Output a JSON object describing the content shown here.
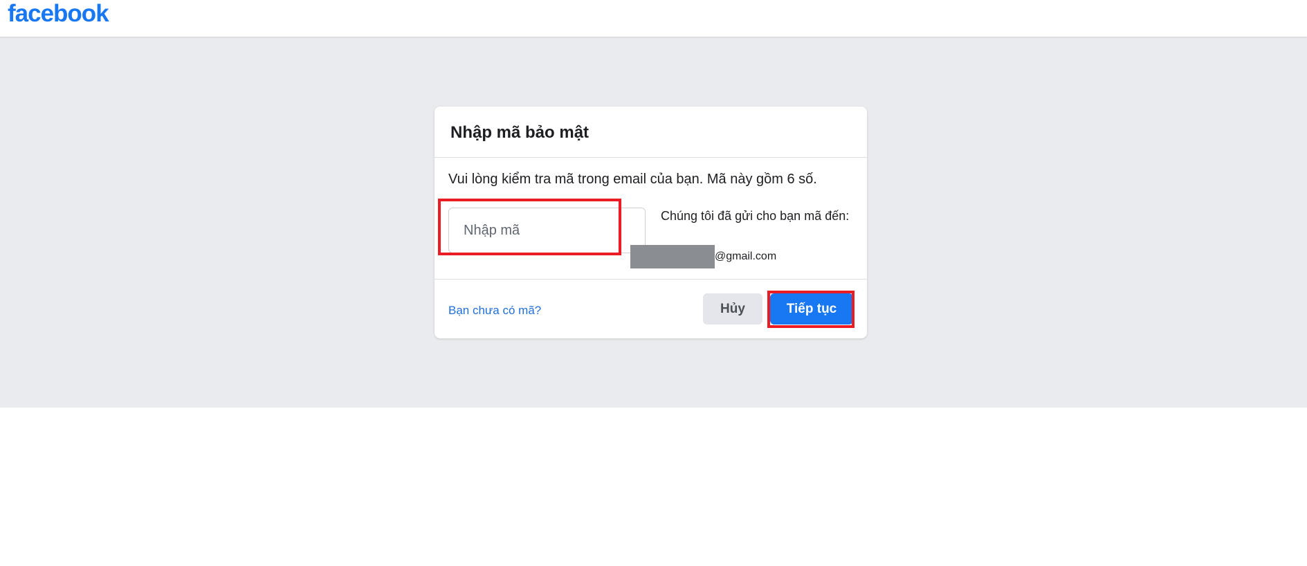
{
  "brand": {
    "logo_text": "facebook",
    "logo_color": "#1877f2"
  },
  "colors": {
    "page_background": "#e9ebee",
    "accent": "#1877f2",
    "highlight": "#ec1c24",
    "link": "#216fdb"
  },
  "dialog": {
    "title": "Nhập mã bảo mật",
    "instructions": "Vui lòng kiểm tra mã trong email của bạn. Mã này gồm 6 số.",
    "code_input": {
      "placeholder": "Nhập mã",
      "value": ""
    },
    "sent_to_label": "Chúng tôi đã gửi cho bạn mã đến:",
    "email_domain": "@gmail.com",
    "no_code_link": "Bạn chưa có mã?",
    "cancel_label": "Hủy",
    "continue_label": "Tiếp tục"
  }
}
